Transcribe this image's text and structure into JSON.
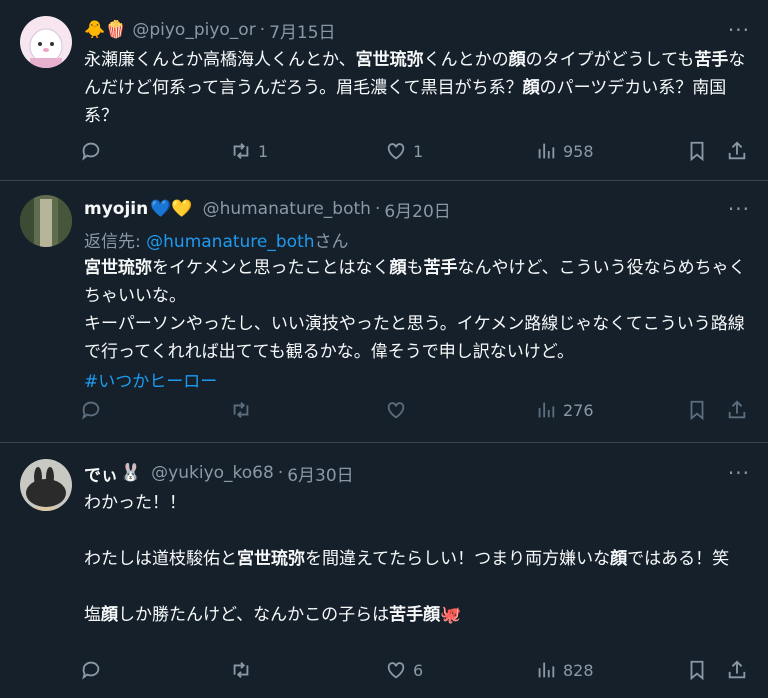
{
  "tweets": [
    {
      "name_emoji": "🐥🍿",
      "handle": "@piyo_piyo_or",
      "date": "7月15日",
      "body_html": "永瀬廉くんとか高橋海人くんとか、<b>宮世琉弥</b>くんとかの<b>顔</b>のタイプがどうしても<b>苦手</b>なんだけど何系って言うんだろう。眉毛濃くて黒目がち系？<b>顔</b>のパーツデカい系？南国系？",
      "replies": "",
      "retweets": "1",
      "likes": "1",
      "views": "958",
      "avatar_color": "#f4d7ea"
    },
    {
      "name": "myojin",
      "name_emoji": "💙💛",
      "handle": "@humanature_both",
      "date": "6月20日",
      "reply_label": "返信先:",
      "reply_handle": "@humanature_both",
      "reply_suffix": "さん",
      "body_html": "<b>宮世琉弥</b>をイケメンと思ったことはなく<b>顔</b>も<b>苦手</b>なんやけど、こういう役ならめちゃくちゃいいな。<br>キーパーソンやったし、いい演技やったと思う。イケメン路線じゃなくてこういう路線で行ってくれれば出てても観るかな。偉そうで申し訳ないけど。",
      "hashtag": "#いつかヒーロー",
      "replies": "",
      "retweets": "",
      "likes": "",
      "views": "276"
    },
    {
      "name": "でぃ",
      "name_emoji": "🐰",
      "handle": "@yukiyo_ko68",
      "date": "6月30日",
      "body_html": "わかった！！<br><br>わたしは道枝駿佑と<b>宮世琉弥</b>を間違えてたらしい！つまり両方嫌いな<b>顔</b>ではある！笑<br><br>塩<b>顔</b>しか勝たんけど、なんかこの子らは<b>苦手顔</b>🐙",
      "replies": "",
      "retweets": "",
      "likes": "6",
      "views": "828"
    }
  ],
  "more_label": "···",
  "separator": "·",
  "icons": [
    "reply-icon",
    "retweet-icon",
    "like-icon",
    "views-icon",
    "bookmark-icon",
    "share-icon"
  ]
}
